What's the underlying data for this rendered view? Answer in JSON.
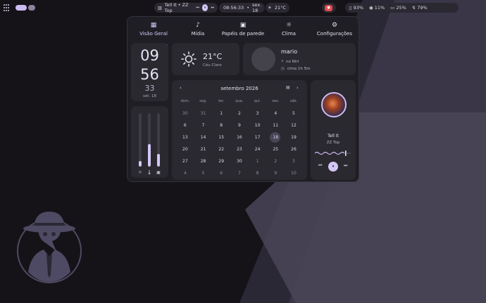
{
  "colors": {
    "accent": "#cdbcf2",
    "desktop_bg": "#151318",
    "panel_bg": "#1f1e24",
    "card_bg": "#2a2930",
    "record_red": "#e34b4b"
  },
  "topbar": {
    "apps_icon": "apps-grid-icon",
    "media": {
      "track": "Tell It • ZZ Top",
      "prev": "⏮",
      "play": "⏸",
      "next": "⏭"
    },
    "clock": {
      "time": "08:56:33",
      "separator": "•",
      "date": "sex. 18"
    },
    "weather": {
      "icon": "☀",
      "temp": "21°C"
    },
    "record": "●",
    "tray": [
      {
        "icon": "▯",
        "value": "93%"
      },
      {
        "icon": "◉",
        "value": "11%"
      },
      {
        "icon": "▭",
        "value": "25%"
      },
      {
        "icon": "↯",
        "value": "79%"
      }
    ]
  },
  "tabs": [
    {
      "icon": "▦",
      "label": "Visão Geral",
      "active": true
    },
    {
      "icon": "♪",
      "label": "Mídia"
    },
    {
      "icon": "▣",
      "label": "Papéis de parede"
    },
    {
      "icon": "☼",
      "label": "Clima"
    },
    {
      "icon": "⚙",
      "label": "Configurações"
    }
  ],
  "clock": {
    "hours": "09",
    "minutes": "56",
    "seconds": "33",
    "date": "set. 18"
  },
  "weather": {
    "temp": "21°C",
    "desc": "Céu Claro",
    "icon": "sun-icon"
  },
  "user": {
    "name": "mario",
    "row1": {
      "icon": "⩘",
      "text": "no Niri"
    },
    "row2": {
      "icon": "◷",
      "text": "cima 1h 5m"
    }
  },
  "sliders": [
    {
      "name": "brightness",
      "icon": "☼",
      "level": 0.1
    },
    {
      "name": "temperature",
      "icon": "🌡",
      "level": 0.42
    },
    {
      "name": "volume",
      "icon": "▣",
      "level": 0.24
    }
  ],
  "calendar": {
    "title": "setembro 2026",
    "prev": "‹",
    "next": "›",
    "today_icon": "▤",
    "weekdays": [
      "dom.",
      "seg.",
      "ter.",
      "qua.",
      "qui.",
      "sex.",
      "sáb."
    ],
    "weeks": [
      [
        "30",
        "31",
        "1",
        "2",
        "3",
        "4",
        "5"
      ],
      [
        "6",
        "7",
        "8",
        "9",
        "10",
        "11",
        "12"
      ],
      [
        "13",
        "14",
        "15",
        "16",
        "17",
        "18",
        "19"
      ],
      [
        "20",
        "21",
        "22",
        "23",
        "24",
        "25",
        "26"
      ],
      [
        "27",
        "28",
        "29",
        "30",
        "1",
        "2",
        "3"
      ],
      [
        "4",
        "5",
        "6",
        "7",
        "8",
        "9",
        "10"
      ]
    ],
    "today": "18"
  },
  "player": {
    "title": "Tell It",
    "artist": "ZZ Top",
    "prev": "⏮",
    "play": "⏸",
    "next": "⏭"
  }
}
